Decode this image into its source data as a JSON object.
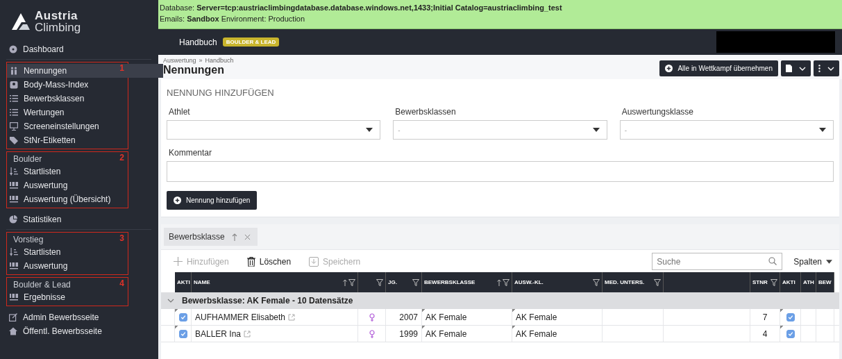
{
  "sidebar": {
    "logo": {
      "line1": "Austria",
      "line2": "Climbing"
    },
    "blocks": [
      {
        "kind": "plain",
        "items": [
          {
            "label": "Dashboard",
            "selected": false
          }
        ]
      },
      {
        "kind": "marked",
        "marker": "1",
        "items": [
          {
            "label": "Nennungen",
            "selected": true
          },
          {
            "label": "Body-Mass-Index",
            "selected": false
          },
          {
            "label": "Bewerbsklassen",
            "selected": false
          },
          {
            "label": "Wertungen",
            "selected": false
          },
          {
            "label": "Screeneinstellungen",
            "selected": false
          },
          {
            "label": "StNr-Etiketten",
            "selected": false
          }
        ]
      },
      {
        "kind": "marked",
        "marker": "2",
        "heading": "Boulder",
        "items": [
          {
            "label": "Startlisten",
            "selected": false
          },
          {
            "label": "Auswertung",
            "selected": false
          },
          {
            "label": "Auswertung (Übersicht)",
            "selected": false
          }
        ]
      },
      {
        "kind": "plain",
        "items": [
          {
            "label": "Statistiken",
            "selected": false
          }
        ]
      },
      {
        "kind": "marked",
        "marker": "3",
        "heading": "Vorstieg",
        "items": [
          {
            "label": "Startlisten",
            "selected": false
          },
          {
            "label": "Auswertung",
            "selected": false
          }
        ]
      },
      {
        "kind": "marked",
        "marker": "4",
        "heading": "Boulder & Lead",
        "items": [
          {
            "label": "Ergebnisse",
            "selected": false
          }
        ]
      },
      {
        "kind": "plain",
        "items": [
          {
            "label": "Admin Bewerbsseite",
            "selected": false
          },
          {
            "label": "Öffentl. Bewerbsseite",
            "selected": false
          }
        ]
      }
    ]
  },
  "env_banner": {
    "lines": [
      "Database: **Server=tcp:austriaclimbingdatabase.database.windows.net,1433;Initial Catalog=austriaclimbing_test**",
      "Emails: **Sandbox** Environment: Production"
    ]
  },
  "navbar": {
    "title": "Handbuch",
    "badge": "BOULDER & LEAD"
  },
  "page_header": {
    "breadcrumb": [
      "Auswertung",
      "»",
      "Handbuch"
    ],
    "title": "Nennungen",
    "primary_button": "Alle in Wettkampf übernehmen"
  },
  "form": {
    "title": "NENNUNG HINZUFÜGEN",
    "selects": [
      {
        "label": "Athlet"
      },
      {
        "label": "Bewerbsklassen",
        "value": "-"
      },
      {
        "label": "Auswertungsklasse",
        "value": "-"
      }
    ],
    "comment_label": "Kommentar",
    "submit": "Nennung hinzufügen"
  },
  "grouping_chip": {
    "label": "Bewerbsklasse"
  },
  "toolbar": {
    "buttons": [
      {
        "label": "Hinzufügen",
        "disabled": true
      },
      {
        "label": "Löschen",
        "disabled": false
      },
      {
        "label": "Speichern",
        "disabled": true
      }
    ],
    "search": {
      "placeholder": "Suche"
    },
    "columns_button": "Spalten"
  },
  "table": {
    "columns": [
      {
        "label": "AKTI"
      },
      {
        "label": "NAME",
        "sortable": true,
        "filterable": true
      },
      {
        "sortable": false,
        "filterable": true
      },
      {
        "label": "JG.",
        "sortable": false,
        "filterable": true
      },
      {
        "label": "BEWERBSKLASSE",
        "sortable": true,
        "filterable": true
      },
      {
        "label": "AUSW.-KL.",
        "sortable": false,
        "filterable": true
      },
      {
        "label": "MED. UNTERS.",
        "sortable": false,
        "filterable": true
      },
      {
        "sortable": false,
        "filterable": false
      },
      {
        "label": "STNR",
        "sortable": false,
        "filterable": true
      },
      {
        "label": "AKTI"
      },
      {
        "label": "ATH"
      },
      {
        "label": "BEW"
      }
    ],
    "group": {
      "label": "Bewerbsklasse: AK Female - 10 Datensätze",
      "expanded": true
    },
    "rows": [
      {
        "active": true,
        "name": "AUFHAMMER Elisabeth",
        "jg": "2007",
        "class": "AK Female",
        "ausw": "AK Female",
        "stnr": "7",
        "active2": true
      },
      {
        "active": true,
        "name": "BALLER Ina",
        "jg": "1999",
        "class": "AK Female",
        "ausw": "AK Female",
        "stnr": "4",
        "active2": true
      }
    ]
  }
}
